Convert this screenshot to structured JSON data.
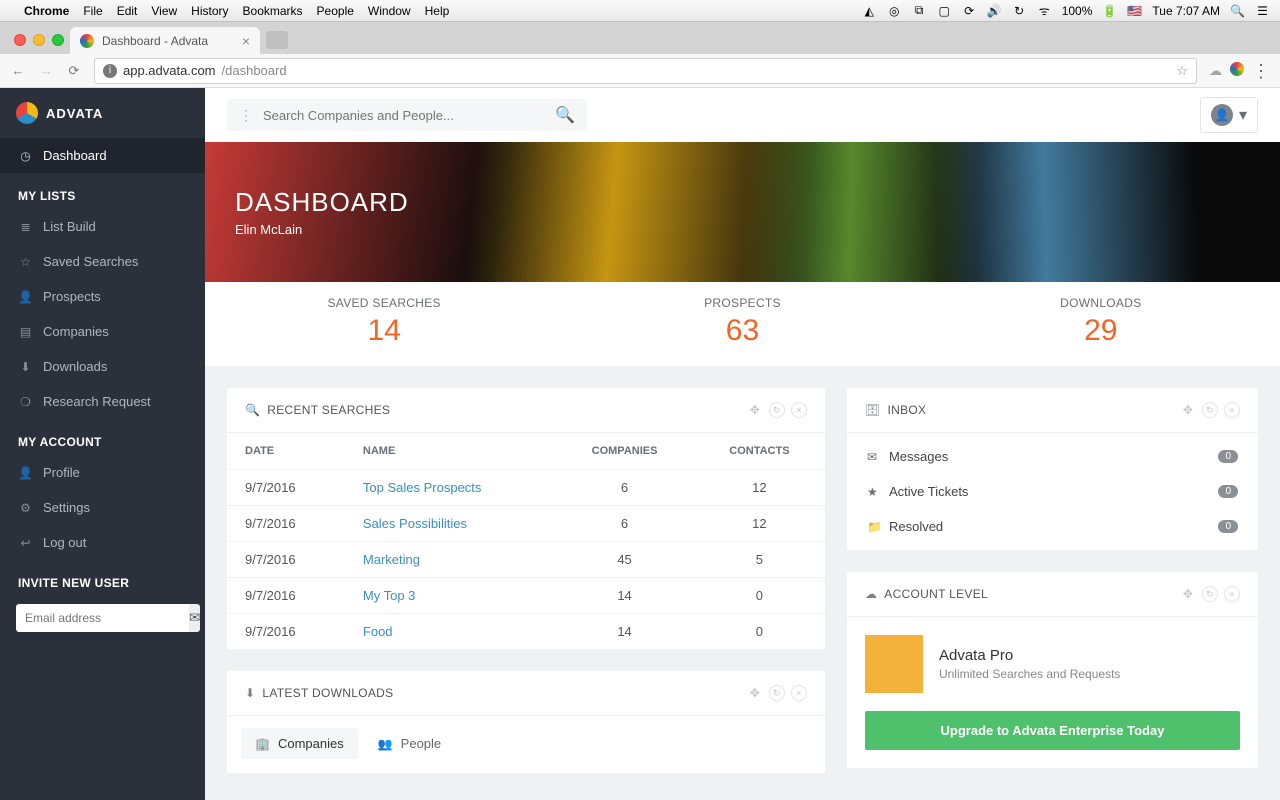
{
  "mac_menu": {
    "app": "Chrome",
    "items": [
      "File",
      "Edit",
      "View",
      "History",
      "Bookmarks",
      "People",
      "Window",
      "Help"
    ],
    "battery": "100%",
    "clock": "Tue 7:07 AM"
  },
  "browser": {
    "tab_title": "Dashboard - Advata",
    "url_host": "app.advata.com",
    "url_path": "/dashboard"
  },
  "brand": "ADVATA",
  "search_placeholder": "Search Companies and People...",
  "sidebar": {
    "dashboard": "Dashboard",
    "sections": {
      "my_lists": "MY LISTS",
      "my_account": "MY ACCOUNT",
      "invite": "INVITE NEW USER"
    },
    "my_lists": [
      {
        "label": "List Build",
        "icon": "≣"
      },
      {
        "label": "Saved Searches",
        "icon": "☆"
      },
      {
        "label": "Prospects",
        "icon": "👤"
      },
      {
        "label": "Companies",
        "icon": "▤"
      },
      {
        "label": "Downloads",
        "icon": "⬇"
      },
      {
        "label": "Research Request",
        "icon": "❍"
      }
    ],
    "my_account": [
      {
        "label": "Profile",
        "icon": "👤"
      },
      {
        "label": "Settings",
        "icon": "⚙"
      },
      {
        "label": "Log out",
        "icon": "↩"
      }
    ],
    "invite_placeholder": "Email address"
  },
  "hero": {
    "title": "DASHBOARD",
    "user": "Elin McLain"
  },
  "stats": [
    {
      "label": "SAVED SEARCHES",
      "value": "14"
    },
    {
      "label": "PROSPECTS",
      "value": "63"
    },
    {
      "label": "DOWNLOADS",
      "value": "29"
    }
  ],
  "recent_searches": {
    "title": "RECENT SEARCHES",
    "columns": {
      "date": "DATE",
      "name": "NAME",
      "companies": "COMPANIES",
      "contacts": "CONTACTS"
    },
    "rows": [
      {
        "date": "9/7/2016",
        "name": "Top Sales Prospects",
        "companies": "6",
        "contacts": "12"
      },
      {
        "date": "9/7/2016",
        "name": "Sales Possibilities",
        "companies": "6",
        "contacts": "12"
      },
      {
        "date": "9/7/2016",
        "name": "Marketing",
        "companies": "45",
        "contacts": "5"
      },
      {
        "date": "9/7/2016",
        "name": "My Top 3",
        "companies": "14",
        "contacts": "0"
      },
      {
        "date": "9/7/2016",
        "name": "Food",
        "companies": "14",
        "contacts": "0"
      }
    ]
  },
  "latest_downloads": {
    "title": "LATEST DOWNLOADS",
    "tabs": [
      {
        "label": "Companies",
        "active": true
      },
      {
        "label": "People",
        "active": false
      }
    ]
  },
  "inbox": {
    "title": "INBOX",
    "items": [
      {
        "icon": "✉",
        "label": "Messages",
        "count": "0"
      },
      {
        "icon": "★",
        "label": "Active Tickets",
        "count": "0"
      },
      {
        "icon": "📁",
        "label": "Resolved",
        "count": "0"
      }
    ]
  },
  "account_level": {
    "title": "ACCOUNT LEVEL",
    "plan": "Advata Pro",
    "desc": "Unlimited Searches and Requests",
    "cta": "Upgrade to Advata Enterprise Today"
  }
}
